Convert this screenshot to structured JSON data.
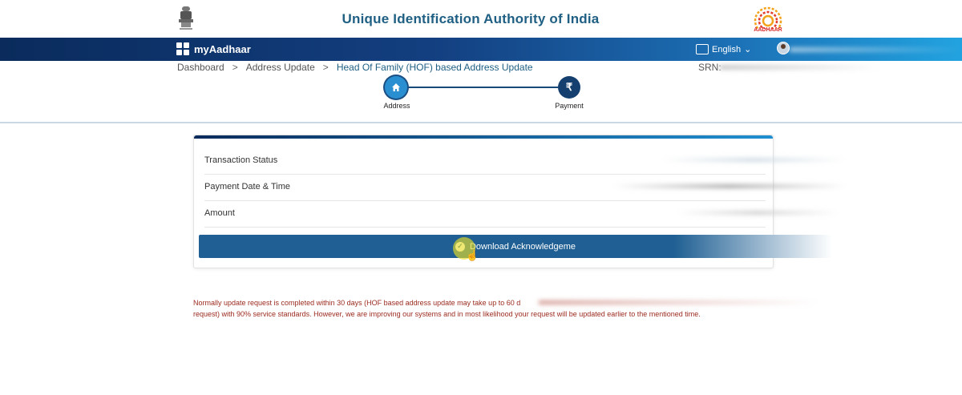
{
  "header": {
    "org_title": "Unique Identification Authority of India",
    "aadhaar_logo_text": "AADHAAR"
  },
  "navbar": {
    "brand": "myAadhaar",
    "language": "English"
  },
  "breadcrumb": {
    "items": [
      "Dashboard",
      "Address Update",
      "Head Of Family (HOF) based Address Update"
    ],
    "separator": ">"
  },
  "srn_label": "SRN:",
  "stepper": {
    "steps": [
      {
        "label": "Address",
        "icon": "home-icon"
      },
      {
        "label": "Payment",
        "icon": "rupee-icon"
      }
    ]
  },
  "card": {
    "rows": [
      {
        "label": "Transaction Status"
      },
      {
        "label": "Payment Date & Time"
      },
      {
        "label": "Amount"
      }
    ],
    "download_button": "Download Acknowledgeme"
  },
  "note": {
    "line1": "Normally update request is completed within 30 days (HOF based address update may take up to 60 d",
    "line2": "request) with 90% service standards. However, we are improving our systems and in most likelihood your request will be updated earlier to the mentioned time."
  },
  "colors": {
    "brand_blue": "#1f5f83",
    "nav_dark": "#0a2b5c",
    "note_red": "#9b2b1f"
  }
}
